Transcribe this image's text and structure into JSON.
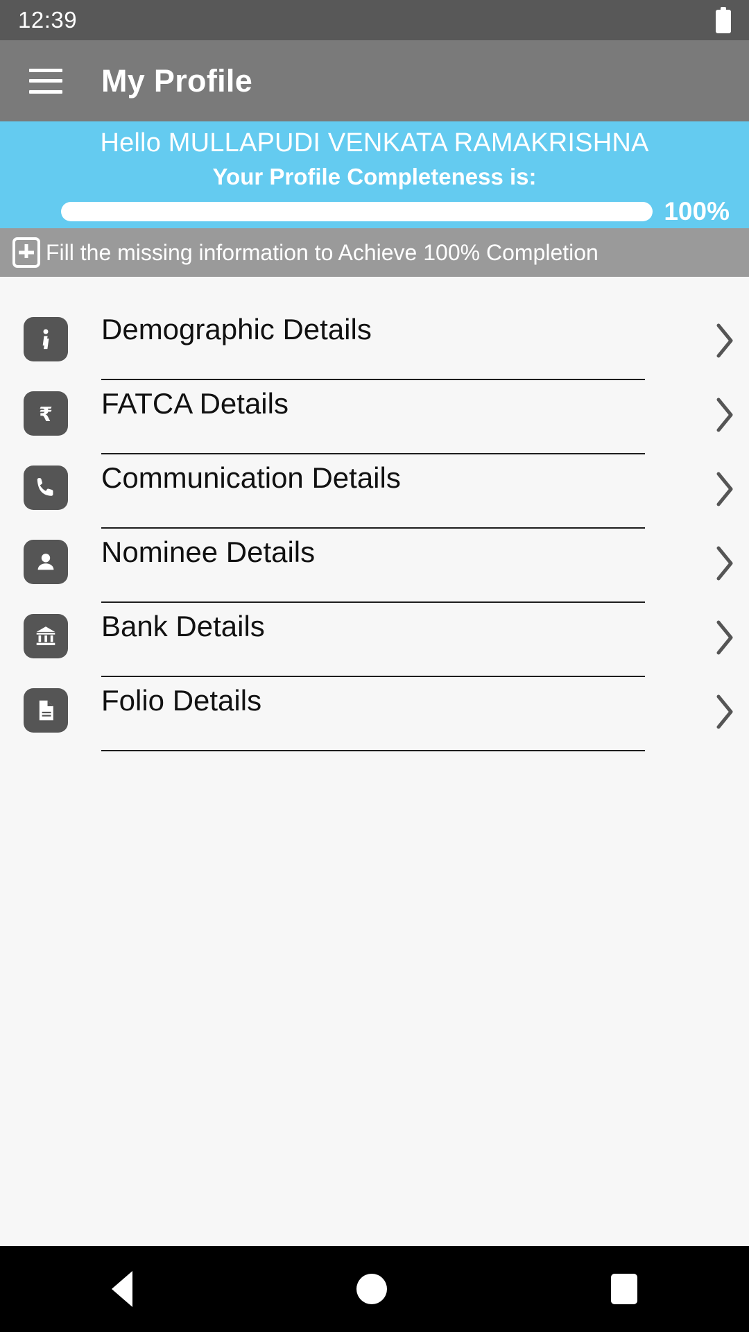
{
  "statusbar": {
    "time": "12:39",
    "battery_icon": "battery-icon"
  },
  "appbar": {
    "menu_icon": "hamburger-menu-icon",
    "title": "My Profile"
  },
  "greeting": {
    "hello_line": "Hello MULLAPUDI VENKATA RAMAKRISHNA",
    "completeness_label": "Your Profile Completeness is:",
    "progress_percent_label": "100%",
    "progress_value": 100,
    "banner_color": "#64cbf0"
  },
  "hint": {
    "icon": "plus-box-icon",
    "text": "Fill the missing information to Achieve 100% Completion",
    "background_color": "#9a9a9a"
  },
  "list": {
    "items": [
      {
        "label": "Demographic Details",
        "icon": "info-icon",
        "chevron": "chevron-right-icon"
      },
      {
        "label": "FATCA Details",
        "icon": "rupee-icon",
        "chevron": "chevron-right-icon"
      },
      {
        "label": "Communication Details",
        "icon": "phone-icon",
        "chevron": "chevron-right-icon"
      },
      {
        "label": "Nominee Details",
        "icon": "person-icon",
        "chevron": "chevron-right-icon"
      },
      {
        "label": "Bank Details",
        "icon": "bank-icon",
        "chevron": "chevron-right-icon"
      },
      {
        "label": "Folio Details",
        "icon": "document-icon",
        "chevron": "chevron-right-icon"
      }
    ]
  },
  "navbar": {
    "back": "back-triangle-icon",
    "home": "home-circle-icon",
    "recents": "recents-square-icon"
  }
}
